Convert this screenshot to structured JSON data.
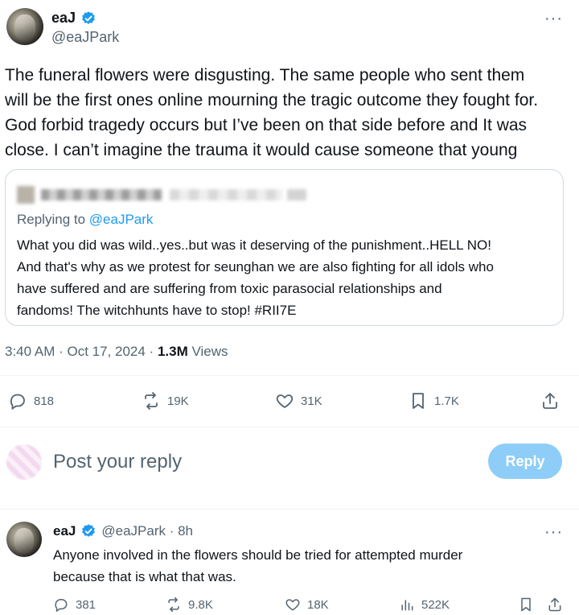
{
  "main_tweet": {
    "display_name": "eaJ",
    "handle": "@eaJPark",
    "more": "···",
    "text": [
      "The funeral flowers were disgusting. The same people who sent them",
      "will be the first ones online mourning the tragic outcome they fought for.",
      "God forbid tragedy occurs but I’ve been on that side before and It was",
      "close. I can’t imagine the trauma it would cause someone that young"
    ],
    "quote": {
      "replying_prefix": "Replying to ",
      "replying_handle": "@eaJPark",
      "text": [
        "What you did was wild..yes..but was it deserving of the punishment..HELL NO!",
        "And that's why as we protest for seunghan we are also fighting for all idols who",
        "have suffered and are suffering from toxic parasocial relationships and",
        "fandoms! The witchhunts have to stop! #RII7E"
      ]
    },
    "timestamp": "3:40 AM · Oct 17, 2024 · ",
    "views_count": "1.3M",
    "views_label": " Views",
    "actions": {
      "replies": "818",
      "reposts": "19K",
      "likes": "31K",
      "bookmarks": "1.7K"
    }
  },
  "reply_composer": {
    "placeholder": "Post your reply",
    "button": "Reply"
  },
  "reply_tweet": {
    "display_name": "eaJ",
    "handle_time": "@eaJPark · 8h",
    "more": "···",
    "text": [
      "Anyone involved in the flowers should be tried for attempted murder",
      "because that is what that was."
    ],
    "actions": {
      "replies": "381",
      "reposts": "9.8K",
      "likes": "18K",
      "views": "522K"
    }
  },
  "colors": {
    "accent": "#1d9bf0",
    "secondary_text": "#536471",
    "reply_button": "#8ecdf7"
  }
}
